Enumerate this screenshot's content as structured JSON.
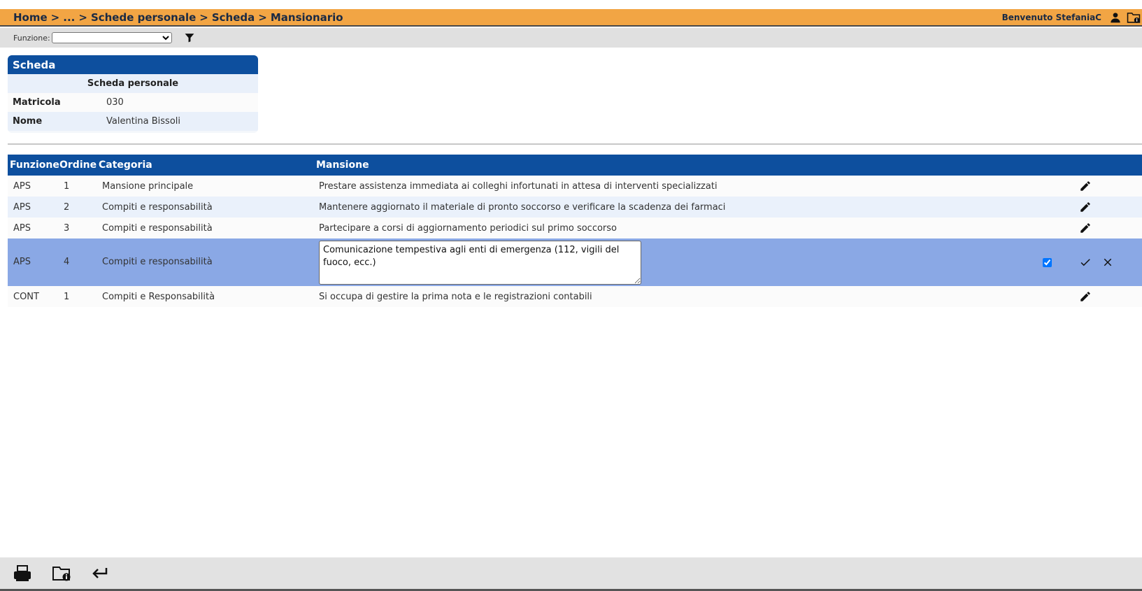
{
  "header": {
    "breadcrumb": [
      "Home",
      "...",
      "Schede personale",
      "Scheda",
      "Mansionario"
    ],
    "separator": ">",
    "welcome": "Benvenuto StefaniaC",
    "accent": "#f2a544"
  },
  "toolbar": {
    "filter_label": "Funzione:",
    "filter_value": ""
  },
  "scheda": {
    "title": "Scheda",
    "subtitle": "Scheda personale",
    "fields": [
      {
        "label": "Matricola",
        "value": "030"
      },
      {
        "label": "Nome",
        "value": "Valentina Bissoli"
      }
    ]
  },
  "grid": {
    "columns": [
      "Funzione",
      "Ordine",
      "Categoria",
      "Mansione"
    ],
    "rows": [
      {
        "funzione": "APS",
        "ordine": "1",
        "categoria": "Mansione principale",
        "mansione": "Prestare assistenza immediata ai colleghi infortunati in attesa di interventi specializzati"
      },
      {
        "funzione": "APS",
        "ordine": "2",
        "categoria": "Compiti e responsabilità",
        "mansione": "Mantenere aggiornato il materiale di pronto soccorso e verificare la scadenza dei farmaci"
      },
      {
        "funzione": "APS",
        "ordine": "3",
        "categoria": "Compiti e responsabilità",
        "mansione": "Partecipare a corsi di aggiornamento periodici sul primo soccorso"
      },
      {
        "funzione": "APS",
        "ordine": "4",
        "categoria": "Compiti e responsabilità",
        "mansione": "Comunicazione tempestiva agli enti di emergenza (112, vigili del fuoco, ecc.)",
        "editing": true,
        "checked": true
      },
      {
        "funzione": "CONT",
        "ordine": "1",
        "categoria": "Compiti e Responsabilità",
        "mansione": "Si occupa di gestire la prima nota e le registrazioni contabili"
      }
    ],
    "header_color": "#0d4f9e",
    "edit_row_color": "#8aa8e5"
  },
  "footer": {
    "icons": [
      "printer-icon",
      "folder-info-icon",
      "return-icon"
    ]
  }
}
